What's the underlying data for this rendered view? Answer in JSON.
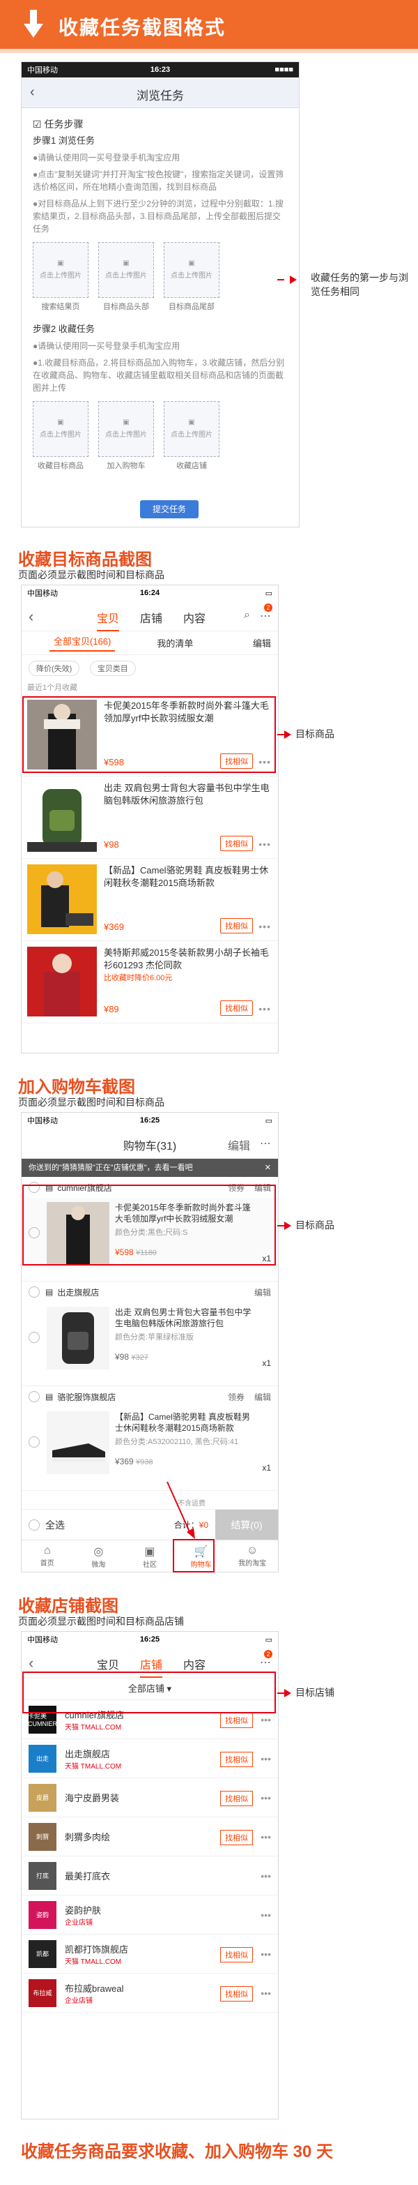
{
  "banner": {
    "title": "收藏任务截图格式"
  },
  "browse": {
    "carrier": "中国移动",
    "time": "16:23",
    "battery": "■■■■",
    "nav_title": "浏览任务",
    "steps_label": "任务步骤",
    "step1_title": "步骤1 浏览任务",
    "step1_b1": "●请确认使用同一买号登录手机淘宝应用",
    "step1_b2": "●点击\"复制关键词\"并打开淘宝\"按色按键\"，搜索指定关键词，设置筛选价格区间，所在地精小查询范围，找到目标商品",
    "step1_b3": "●对目标商品从上到下进行至少2分钟的浏览，过程中分别截取：1.搜索结果页，2.目标商品头部，3.目标商品尾部，上传全部截图后提交任务",
    "uploads1": [
      "点击上传图片",
      "点击上传图片",
      "点击上传图片"
    ],
    "uploads1_caps": [
      "搜索结果页",
      "目标商品头部",
      "目标商品尾部"
    ],
    "step2_title": "步骤2 收藏任务",
    "step2_b1": "●请确认使用同一买号登录手机淘宝应用",
    "step2_b2": "●1.收藏目标商品，2.将目标商品加入购物车，3.收藏店铺，然后分别在收藏商品、购物车、收藏店铺里截取相关目标商品和店铺的页面截图并上传",
    "uploads2": [
      "点击上传图片",
      "点击上传图片",
      "点击上传图片"
    ],
    "uploads2_caps": [
      "收藏目标商品",
      "加入购物车",
      "收藏店铺"
    ],
    "submit": "提交任务",
    "note": "收藏任务的第一步与浏览任务相同"
  },
  "fav_goods": {
    "title": "收藏目标商品截图",
    "sub": "页面必须显示截图时间和目标商品",
    "carrier": "中国移动",
    "time": "16:24",
    "tabs": [
      "宝贝",
      "店铺",
      "内容"
    ],
    "badge": "2",
    "filter_all": "全部宝贝(166)",
    "filter_list": "我的清单",
    "filter_edit": "编辑",
    "chips": [
      "降价(失效)",
      "宝贝类目"
    ],
    "recent": "最近1个月收藏",
    "products": [
      {
        "title": "卡伲美2015年冬季新款时尚外套斗篷大毛领加厚yrf中长款羽绒服女潮",
        "price": "¥598",
        "promo": "",
        "sim": "找相似"
      },
      {
        "title": "出走 双肩包男士背包大容量书包中学生电脑包韩版休闲旅游旅行包",
        "price": "¥98",
        "promo": "",
        "sim": "找相似"
      },
      {
        "title": "【新品】Camel骆驼男鞋 真皮板鞋男士休闲鞋秋冬潮鞋2015商场新款",
        "price": "¥369",
        "promo": "",
        "sim": "找相似"
      },
      {
        "title": "美特斯邦威2015冬装新款男小胡子长袖毛衫601293 杰伦同款",
        "price": "¥89",
        "promo": "比收藏时降价6.00元",
        "sim": "找相似"
      }
    ],
    "note": "目标商品"
  },
  "cart": {
    "title": "加入购物车截图",
    "sub": "页面必须显示截图时间和目标商品",
    "carrier": "中国移动",
    "time": "16:25",
    "nav_title": "购物车(31)",
    "edit": "编辑",
    "notice": "你送到的\"猜猜猜服\"正在\"店铺优惠\"，去看一看吧",
    "shops": [
      {
        "name": "cumnier旗舰店",
        "coupon": "领券",
        "edit": "编辑"
      },
      {
        "name": "出走旗舰店",
        "coupon": "",
        "edit": "编辑"
      },
      {
        "name": "骆驼服饰旗舰店",
        "coupon": "领券",
        "edit": "编辑"
      }
    ],
    "items": [
      {
        "title": "卡伲美2015年冬季新款时尚外套斗篷大毛领加厚yrf中长款羽绒服女潮",
        "spec": "颜色分类:黑色;尺码:S",
        "price": "¥598",
        "old": "¥1180",
        "qty": "x1"
      },
      {
        "title": "出走 双肩包男士背包大容量书包中学生电脑包韩版休闲旅游旅行包",
        "spec": "颜色分类:苹果绿标准版",
        "price": "¥98",
        "old": "¥327",
        "qty": "x1"
      },
      {
        "title": "【新品】Camel骆驼男鞋 真皮板鞋男士休闲鞋秋冬潮鞋2015商场新款",
        "spec": "颜色分类:A532002110, 黑色;尺码:41",
        "price": "¥369",
        "old": "¥938",
        "qty": "x1"
      }
    ],
    "select_all": "全选",
    "total_label": "合计：",
    "total_value": "¥0",
    "nofee": "不含运费",
    "checkout": "结算(0)",
    "tabbar": [
      "首页",
      "微淘",
      "社区",
      "购物车",
      "我的淘宝"
    ],
    "note": "目标商品"
  },
  "fav_shop": {
    "title": "收藏店铺截图",
    "sub": "页面必须显示截图时间和目标商品店铺",
    "carrier": "中国移动",
    "time": "16:25",
    "tabs": [
      "宝贝",
      "店铺",
      "内容"
    ],
    "badge": "2",
    "all_shops": "全部店铺",
    "shops": [
      {
        "name": "cumnier旗舰店",
        "tag": "天猫 TMALL.COM",
        "logo": "卡伲美 CUMNIER",
        "color": "#111111",
        "sim": "找相似"
      },
      {
        "name": "出走旗舰店",
        "tag": "天猫 TMALL.COM",
        "logo": "出走",
        "color": "#1b7ec8",
        "sim": "找相似"
      },
      {
        "name": "海宁皮爵男装",
        "tag": "",
        "logo": "皮爵",
        "color": "#c8a25a",
        "sim": "找相似"
      },
      {
        "name": "刺猬多肉绘",
        "tag": "",
        "logo": "刺猬",
        "color": "#8a6a4a",
        "sim": "找相似"
      },
      {
        "name": "最美打底衣",
        "tag": "",
        "logo": "打底",
        "color": "#555555",
        "sim": ""
      },
      {
        "name": "姿韵护肤",
        "tag": "企业店铺",
        "logo": "姿韵",
        "color": "#d4145a",
        "sim": ""
      },
      {
        "name": "凯都打饰旗舰店",
        "tag": "天猫 TMALL.COM",
        "logo": "凯都",
        "color": "#222222",
        "sim": "找相似"
      },
      {
        "name": "布拉威braweal",
        "tag": "企业店铺",
        "logo": "布拉威",
        "color": "#b4141e",
        "sim": "找相似"
      }
    ],
    "note": "目标店铺"
  },
  "footer": "收藏任务商品要求收藏、加入购物车 30 天"
}
